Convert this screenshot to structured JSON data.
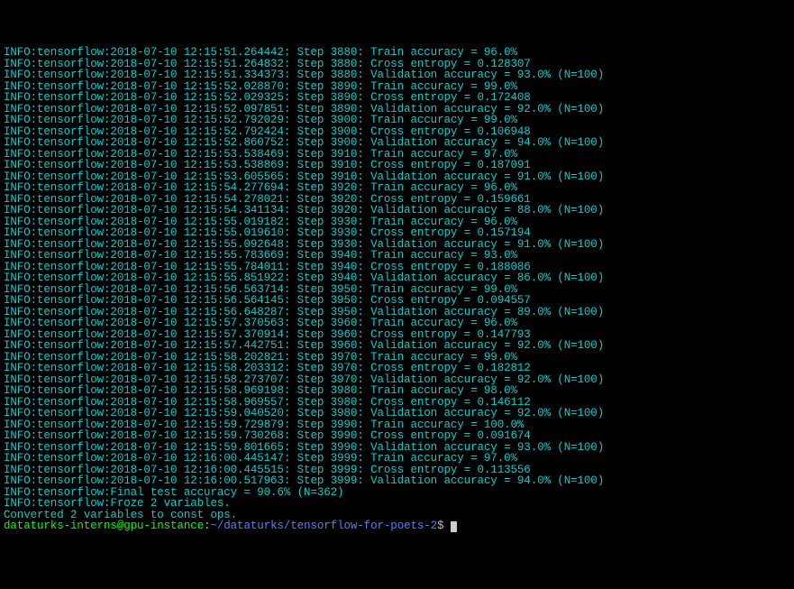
{
  "lines": [
    "INFO:tensorflow:2018-07-10 12:15:51.264442: Step 3880: Train accuracy = 96.0%",
    "INFO:tensorflow:2018-07-10 12:15:51.264832: Step 3880: Cross entropy = 0.128307",
    "INFO:tensorflow:2018-07-10 12:15:51.334373: Step 3880: Validation accuracy = 93.0% (N=100)",
    "INFO:tensorflow:2018-07-10 12:15:52.028870: Step 3890: Train accuracy = 99.0%",
    "INFO:tensorflow:2018-07-10 12:15:52.029325: Step 3890: Cross entropy = 0.172408",
    "INFO:tensorflow:2018-07-10 12:15:52.097851: Step 3890: Validation accuracy = 92.0% (N=100)",
    "INFO:tensorflow:2018-07-10 12:15:52.792029: Step 3900: Train accuracy = 99.0%",
    "INFO:tensorflow:2018-07-10 12:15:52.792424: Step 3900: Cross entropy = 0.106948",
    "INFO:tensorflow:2018-07-10 12:15:52.860752: Step 3900: Validation accuracy = 94.0% (N=100)",
    "INFO:tensorflow:2018-07-10 12:15:53.538469: Step 3910: Train accuracy = 97.0%",
    "INFO:tensorflow:2018-07-10 12:15:53.538869: Step 3910: Cross entropy = 0.187091",
    "INFO:tensorflow:2018-07-10 12:15:53.605565: Step 3910: Validation accuracy = 91.0% (N=100)",
    "INFO:tensorflow:2018-07-10 12:15:54.277694: Step 3920: Train accuracy = 96.0%",
    "INFO:tensorflow:2018-07-10 12:15:54.278021: Step 3920: Cross entropy = 0.159661",
    "INFO:tensorflow:2018-07-10 12:15:54.341134: Step 3920: Validation accuracy = 88.0% (N=100)",
    "INFO:tensorflow:2018-07-10 12:15:55.019182: Step 3930: Train accuracy = 96.0%",
    "INFO:tensorflow:2018-07-10 12:15:55.019610: Step 3930: Cross entropy = 0.157194",
    "INFO:tensorflow:2018-07-10 12:15:55.092648: Step 3930: Validation accuracy = 91.0% (N=100)",
    "INFO:tensorflow:2018-07-10 12:15:55.783669: Step 3940: Train accuracy = 93.0%",
    "INFO:tensorflow:2018-07-10 12:15:55.784011: Step 3940: Cross entropy = 0.188086",
    "INFO:tensorflow:2018-07-10 12:15:55.851922: Step 3940: Validation accuracy = 86.0% (N=100)",
    "INFO:tensorflow:2018-07-10 12:15:56.563714: Step 3950: Train accuracy = 99.0%",
    "INFO:tensorflow:2018-07-10 12:15:56.564145: Step 3950: Cross entropy = 0.094557",
    "INFO:tensorflow:2018-07-10 12:15:56.648287: Step 3950: Validation accuracy = 89.0% (N=100)",
    "INFO:tensorflow:2018-07-10 12:15:57.370563: Step 3960: Train accuracy = 96.0%",
    "INFO:tensorflow:2018-07-10 12:15:57.370914: Step 3960: Cross entropy = 0.147793",
    "INFO:tensorflow:2018-07-10 12:15:57.442751: Step 3960: Validation accuracy = 92.0% (N=100)",
    "INFO:tensorflow:2018-07-10 12:15:58.202821: Step 3970: Train accuracy = 99.0%",
    "INFO:tensorflow:2018-07-10 12:15:58.203312: Step 3970: Cross entropy = 0.182812",
    "INFO:tensorflow:2018-07-10 12:15:58.273707: Step 3970: Validation accuracy = 92.0% (N=100)",
    "INFO:tensorflow:2018-07-10 12:15:58.969198: Step 3980: Train accuracy = 98.0%",
    "INFO:tensorflow:2018-07-10 12:15:58.969557: Step 3980: Cross entropy = 0.146112",
    "INFO:tensorflow:2018-07-10 12:15:59.040520: Step 3980: Validation accuracy = 92.0% (N=100)",
    "INFO:tensorflow:2018-07-10 12:15:59.729879: Step 3990: Train accuracy = 100.0%",
    "INFO:tensorflow:2018-07-10 12:15:59.730268: Step 3990: Cross entropy = 0.091674",
    "INFO:tensorflow:2018-07-10 12:15:59.801665: Step 3990: Validation accuracy = 93.0% (N=100)",
    "INFO:tensorflow:2018-07-10 12:16:00.445147: Step 3999: Train accuracy = 97.0%",
    "INFO:tensorflow:2018-07-10 12:16:00.445515: Step 3999: Cross entropy = 0.113556",
    "INFO:tensorflow:2018-07-10 12:16:00.517963: Step 3999: Validation accuracy = 94.0% (N=100)",
    "INFO:tensorflow:Final test accuracy = 90.6% (N=362)",
    "INFO:tensorflow:Froze 2 variables.",
    "Converted 2 variables to const ops."
  ],
  "prompt": {
    "user_host": "dataturks-interns@gpu-instance",
    "path": "~/dataturks/tensorflow-for-poets-2",
    "symbol": "$"
  }
}
